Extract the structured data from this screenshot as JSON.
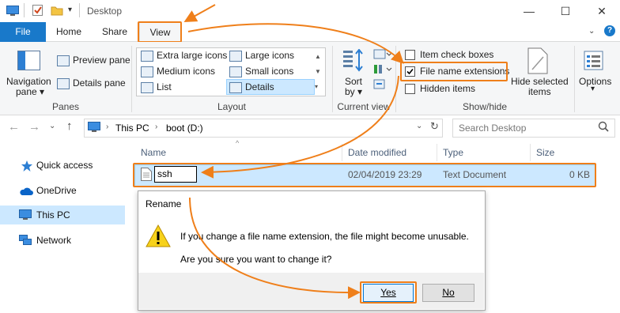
{
  "window": {
    "title": "Desktop",
    "minimize": "—",
    "maximize": "☐",
    "close": "✕"
  },
  "tabs": {
    "file": "File",
    "home": "Home",
    "share": "Share",
    "view": "View"
  },
  "ribbon": {
    "panes": {
      "navigation": "Navigation",
      "navigation2": "pane ▾",
      "preview": "Preview pane",
      "details": "Details pane",
      "label": "Panes"
    },
    "layout": {
      "xl": "Extra large icons",
      "large": "Large icons",
      "medium": "Medium icons",
      "small": "Small icons",
      "list": "List",
      "details": "Details",
      "label": "Layout"
    },
    "current_view": {
      "sort": "Sort",
      "sort2": "by ▾",
      "label": "Current view"
    },
    "show_hide": {
      "item_check": "Item check boxes",
      "file_ext": "File name extensions",
      "hidden": "Hidden items",
      "hide_selected": "Hide selected",
      "hide_selected2": "items",
      "label": "Show/hide"
    },
    "options": {
      "label": "Options",
      "arrow": "▾"
    }
  },
  "address": {
    "this_pc": "This PC",
    "drive": "boot (D:)",
    "search_placeholder": "Search Desktop"
  },
  "nav": {
    "quick_access": "Quick access",
    "onedrive": "OneDrive",
    "this_pc": "This PC",
    "network": "Network"
  },
  "columns": {
    "name": "Name",
    "date": "Date modified",
    "type": "Type",
    "size": "Size"
  },
  "file_row": {
    "name": "ssh",
    "date": "02/04/2019 23:29",
    "type": "Text Document",
    "size": "0 KB"
  },
  "dialog": {
    "title": "Rename",
    "message": "If you change a file name extension, the file might become unusable.",
    "question": "Are you sure you want to change it?",
    "yes": "Yes",
    "no": "No"
  },
  "colors": {
    "accent": "#1979ca",
    "annotation": "#ef7f1a",
    "selection": "#cce8ff"
  }
}
